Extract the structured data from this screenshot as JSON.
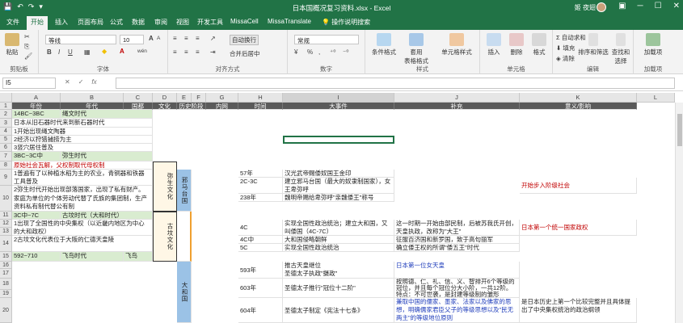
{
  "titlebar": {
    "title": "日本国概况复习资料.xlsx - Excel",
    "user": "姬 夜翅",
    "qa_icons": [
      "save-icon",
      "undo-icon",
      "redo-icon",
      "more-icon"
    ]
  },
  "tabs": [
    "文件",
    "开始",
    "插入",
    "页面布局",
    "公式",
    "数据",
    "审阅",
    "视图",
    "开发工具",
    "MissaCell",
    "MissaTranslate",
    "操作说明搜索"
  ],
  "ribbon": {
    "clipboard": {
      "paste": "粘贴",
      "label": "剪贴板"
    },
    "font": {
      "name": "等线",
      "size": "10",
      "label": "字体",
      "bold": "B",
      "italic": "I",
      "underline": "U",
      "grow": "A",
      "shrink": "A",
      "wen": "wén"
    },
    "align": {
      "wrap": "自动换行",
      "merge": "合并后居中",
      "label": "对齐方式"
    },
    "number": {
      "format": "常规",
      "pct": "%",
      "comma": ",",
      "label": "数字"
    },
    "styles": {
      "cond": "条件格式",
      "table": "套用\n表格格式",
      "cellstyle": "单元格样式",
      "label": "样式"
    },
    "cells": {
      "insert": "插入",
      "delete": "删除",
      "format": "格式",
      "label": "单元格"
    },
    "edit": {
      "autosum": "自动求和",
      "fill": "填充",
      "clear": "清除",
      "sort": "排序和筛选",
      "find": "查找和选择",
      "label": "编辑"
    },
    "addins": {
      "load": "加载项",
      "label": "加载项"
    }
  },
  "formula": {
    "namebox": "I5",
    "fx": "fx"
  },
  "columns": [
    "A",
    "B",
    "C",
    "D",
    "E",
    "F",
    "G",
    "H",
    "I",
    "J",
    "K",
    "L"
  ],
  "rows": [
    "1",
    "2",
    "3",
    "4",
    "5",
    "6",
    "7",
    "8",
    "9",
    "10",
    "11",
    "12",
    "13",
    "14",
    "15",
    "16",
    "17",
    "18",
    "19",
    "20",
    "21",
    "22",
    "23",
    "24",
    "25",
    "26"
  ],
  "header": {
    "year": "年份",
    "era": "年代",
    "nation": "国都",
    "culture": "文化",
    "history": "历史阶段",
    "internal": "内网",
    "time": "时间",
    "event": "大事件",
    "supplement": "补充",
    "meaning": "意义/影响"
  },
  "left": {
    "r2a": "14BC~3BC",
    "r2b": "绳文时代",
    "r3": "日本从旧石器时代来到新石器时代",
    "r4": "1开始出现绳文陶器",
    "r5": "2经济以狩猎捕捞为主",
    "r6": "3竖穴居住普及",
    "r7a": "3BC~3C中",
    "r7b": "弥生时代",
    "r8": "原始社会瓦解，父权制取代母权制",
    "r9": "1普遍有了以种植水稻为主的农业，青铜器和铁器工具普及",
    "r10": "2弥生时代开始出现部落国家，出现了私有财产。家庭为单位的个体劳动代替了氏族的集团制，生产资料私有制代替公有制",
    "r14a": "3C中~7C",
    "r14b": "古坟时代（大和时代）",
    "r15": "1出现了全国性的中央集权（以近畿内地区为中心的大和政权）",
    "r16": "2古坟文化代表位于大阪的仁德天皇陵",
    "r17a": "592~710",
    "r17b": "飞鸟时代",
    "r17c": "飞鸟",
    "culture1": "弥生文化",
    "culture2": "古坟文化",
    "history1": "邪马台国",
    "history2": "大和国"
  },
  "events": [
    {
      "time": "57年",
      "event": "汉光武帝赐倭奴国王金印",
      "supp": "",
      "mean": ""
    },
    {
      "time": "2C-3C",
      "event": "建立邪马台国（最大的奴隶制国家），女王卑弥呼",
      "supp": "",
      "mean": "开始步入阶级社会"
    },
    {
      "time": "238年",
      "event": "魏明帝赐给卑弥呼\"亲魏倭王\"称号",
      "supp": "",
      "mean": ""
    },
    {
      "time": "4C",
      "event": "实现全国性政治统治；建立大和国，又叫倭国（4C-7C）",
      "supp": "这一时期一开始由部民制，后被苏我氏开创，天皇执政，改称为\"大王\"",
      "mean": "日本第一个统一国家政权"
    },
    {
      "time": "4C中",
      "event": "大和国侵略朝鲜",
      "supp": "征服百济国和新罗国，致于高句丽军",
      "mean": ""
    },
    {
      "time": "5C",
      "event": "实现全国性政治统治",
      "supp": "确立倭王权的所谓\"倭五王\"时代",
      "mean": ""
    },
    {
      "time": "593年",
      "event": "推古天皇继位\n圣德太子执政\"摄政\"",
      "supp": "日本第一位女天皇",
      "mean": ""
    },
    {
      "time": "603年",
      "event": "圣德太子推行\"冠位十二阶\"",
      "supp": "按照德、仁、礼、信、义、智排开6个等级的冠位，并且每个冠位分大小阶，一共12阶。特点：不可世袭，是封建等级制的雏形",
      "mean": ""
    },
    {
      "time": "604年",
      "event": "圣德太子制定《宪法十七条》",
      "supp": "兼取中国的儒家、墨家、法家以及佛家的思想，明确儒家君臣父子的等级思想以及\"民无两主\"的等级地位原则",
      "mean": "是日本历史上第一个比较完整并且具体提出了中央集权统治的政治纲领"
    }
  ]
}
